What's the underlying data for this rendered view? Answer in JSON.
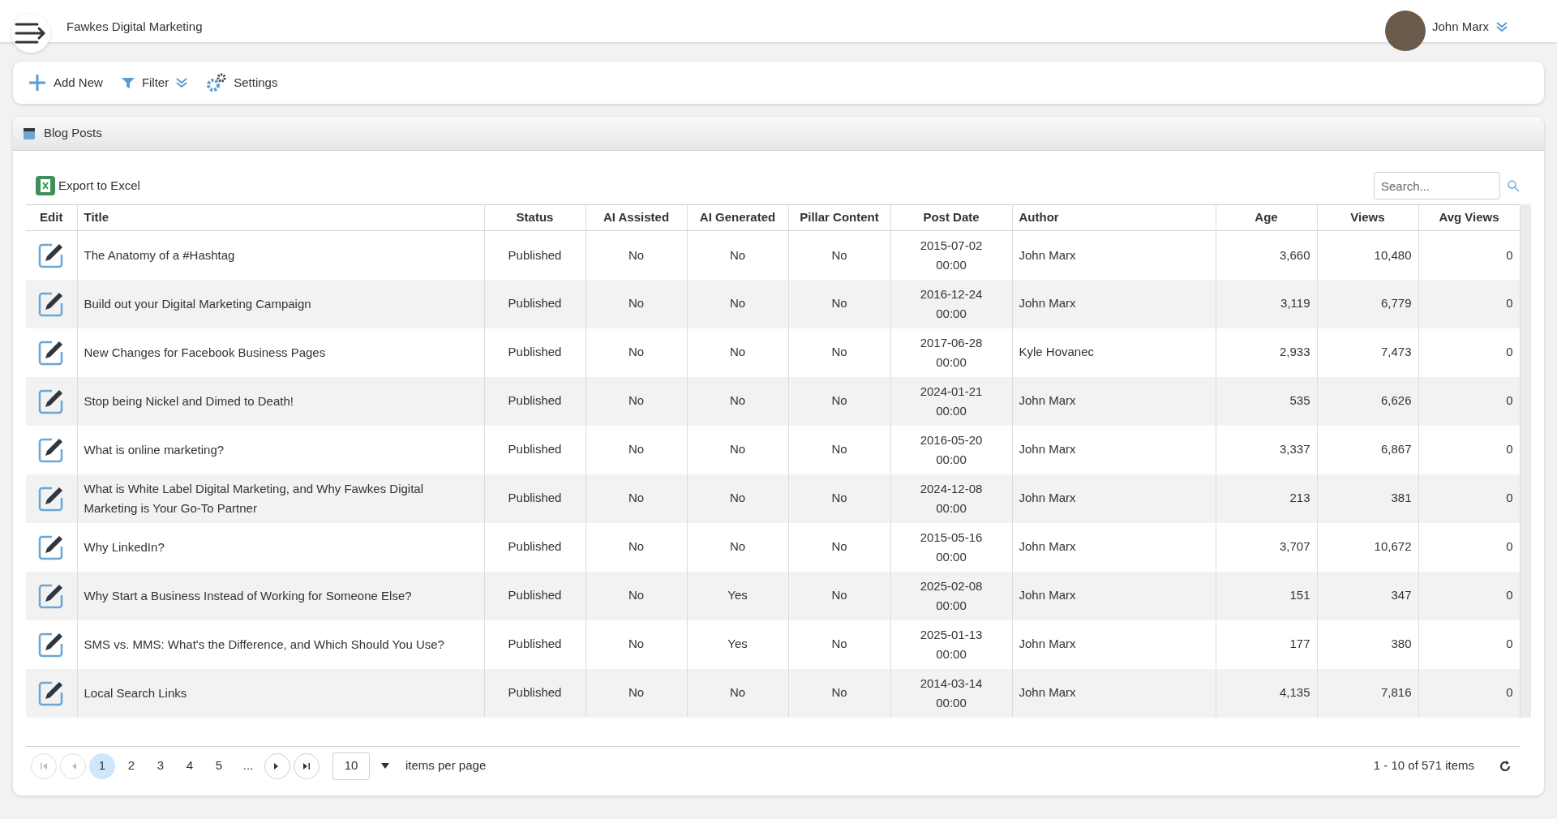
{
  "header": {
    "app_title": "Fawkes Digital Marketing",
    "user_name": "John Marx"
  },
  "toolbar": [
    "Add New",
    "Filter",
    "Settings"
  ],
  "panel": {
    "title": "Blog Posts",
    "export_label": "Export to Excel",
    "search": {
      "placeholder": "Search..."
    }
  },
  "table": {
    "columns": [
      "Edit",
      "Title",
      "Status",
      "AI Assisted",
      "AI Generated",
      "Pillar Content",
      "Post Date",
      "Author",
      "Age",
      "Views",
      "Avg Views"
    ],
    "rows": [
      {
        "title": "The Anatomy of a #Hashtag",
        "status": "Published",
        "ai_assisted": "No",
        "ai_generated": "No",
        "pillar": "No",
        "date": "2015-07-02",
        "time": "00:00",
        "author": "John Marx",
        "age": "3,660",
        "views": "10,480",
        "avg_views": "0"
      },
      {
        "title": "Build out your Digital Marketing Campaign",
        "status": "Published",
        "ai_assisted": "No",
        "ai_generated": "No",
        "pillar": "No",
        "date": "2016-12-24",
        "time": "00:00",
        "author": "John Marx",
        "age": "3,119",
        "views": "6,779",
        "avg_views": "0"
      },
      {
        "title": "New Changes for Facebook Business Pages",
        "status": "Published",
        "ai_assisted": "No",
        "ai_generated": "No",
        "pillar": "No",
        "date": "2017-06-28",
        "time": "00:00",
        "author": "Kyle Hovanec",
        "age": "2,933",
        "views": "7,473",
        "avg_views": "0"
      },
      {
        "title": "Stop being Nickel and Dimed to Death!",
        "status": "Published",
        "ai_assisted": "No",
        "ai_generated": "No",
        "pillar": "No",
        "date": "2024-01-21",
        "time": "00:00",
        "author": "John Marx",
        "age": "535",
        "views": "6,626",
        "avg_views": "0"
      },
      {
        "title": "What is online marketing?",
        "status": "Published",
        "ai_assisted": "No",
        "ai_generated": "No",
        "pillar": "No",
        "date": "2016-05-20",
        "time": "00:00",
        "author": "John Marx",
        "age": "3,337",
        "views": "6,867",
        "avg_views": "0"
      },
      {
        "title": "What is White Label Digital Marketing, and Why Fawkes Digital Marketing is Your Go-To Partner",
        "status": "Published",
        "ai_assisted": "No",
        "ai_generated": "No",
        "pillar": "No",
        "date": "2024-12-08",
        "time": "00:00",
        "author": "John Marx",
        "age": "213",
        "views": "381",
        "avg_views": "0"
      },
      {
        "title": "Why LinkedIn?",
        "status": "Published",
        "ai_assisted": "No",
        "ai_generated": "No",
        "pillar": "No",
        "date": "2015-05-16",
        "time": "00:00",
        "author": "John Marx",
        "age": "3,707",
        "views": "10,672",
        "avg_views": "0"
      },
      {
        "title": "Why Start a Business Instead of Working for Someone Else?",
        "status": "Published",
        "ai_assisted": "No",
        "ai_generated": "Yes",
        "pillar": "No",
        "date": "2025-02-08",
        "time": "00:00",
        "author": "John Marx",
        "age": "151",
        "views": "347",
        "avg_views": "0"
      },
      {
        "title": "SMS vs. MMS: What's the Difference, and Which Should You Use?",
        "status": "Published",
        "ai_assisted": "No",
        "ai_generated": "Yes",
        "pillar": "No",
        "date": "2025-01-13",
        "time": "00:00",
        "author": "John Marx",
        "age": "177",
        "views": "380",
        "avg_views": "0"
      },
      {
        "title": "Local Search Links",
        "status": "Published",
        "ai_assisted": "No",
        "ai_generated": "No",
        "pillar": "No",
        "date": "2014-03-14",
        "time": "00:00",
        "author": "John Marx",
        "age": "4,135",
        "views": "7,816",
        "avg_views": "0"
      }
    ]
  },
  "pager": {
    "pages": [
      {
        "label": "1",
        "selected": true
      },
      {
        "label": "2",
        "selected": false
      },
      {
        "label": "3",
        "selected": false
      },
      {
        "label": "4",
        "selected": false
      },
      {
        "label": "5",
        "selected": false
      },
      {
        "label": "...",
        "selected": false
      }
    ],
    "page_size": "10",
    "page_size_label": "items per page",
    "summary": "1 - 10 of 571 items"
  }
}
